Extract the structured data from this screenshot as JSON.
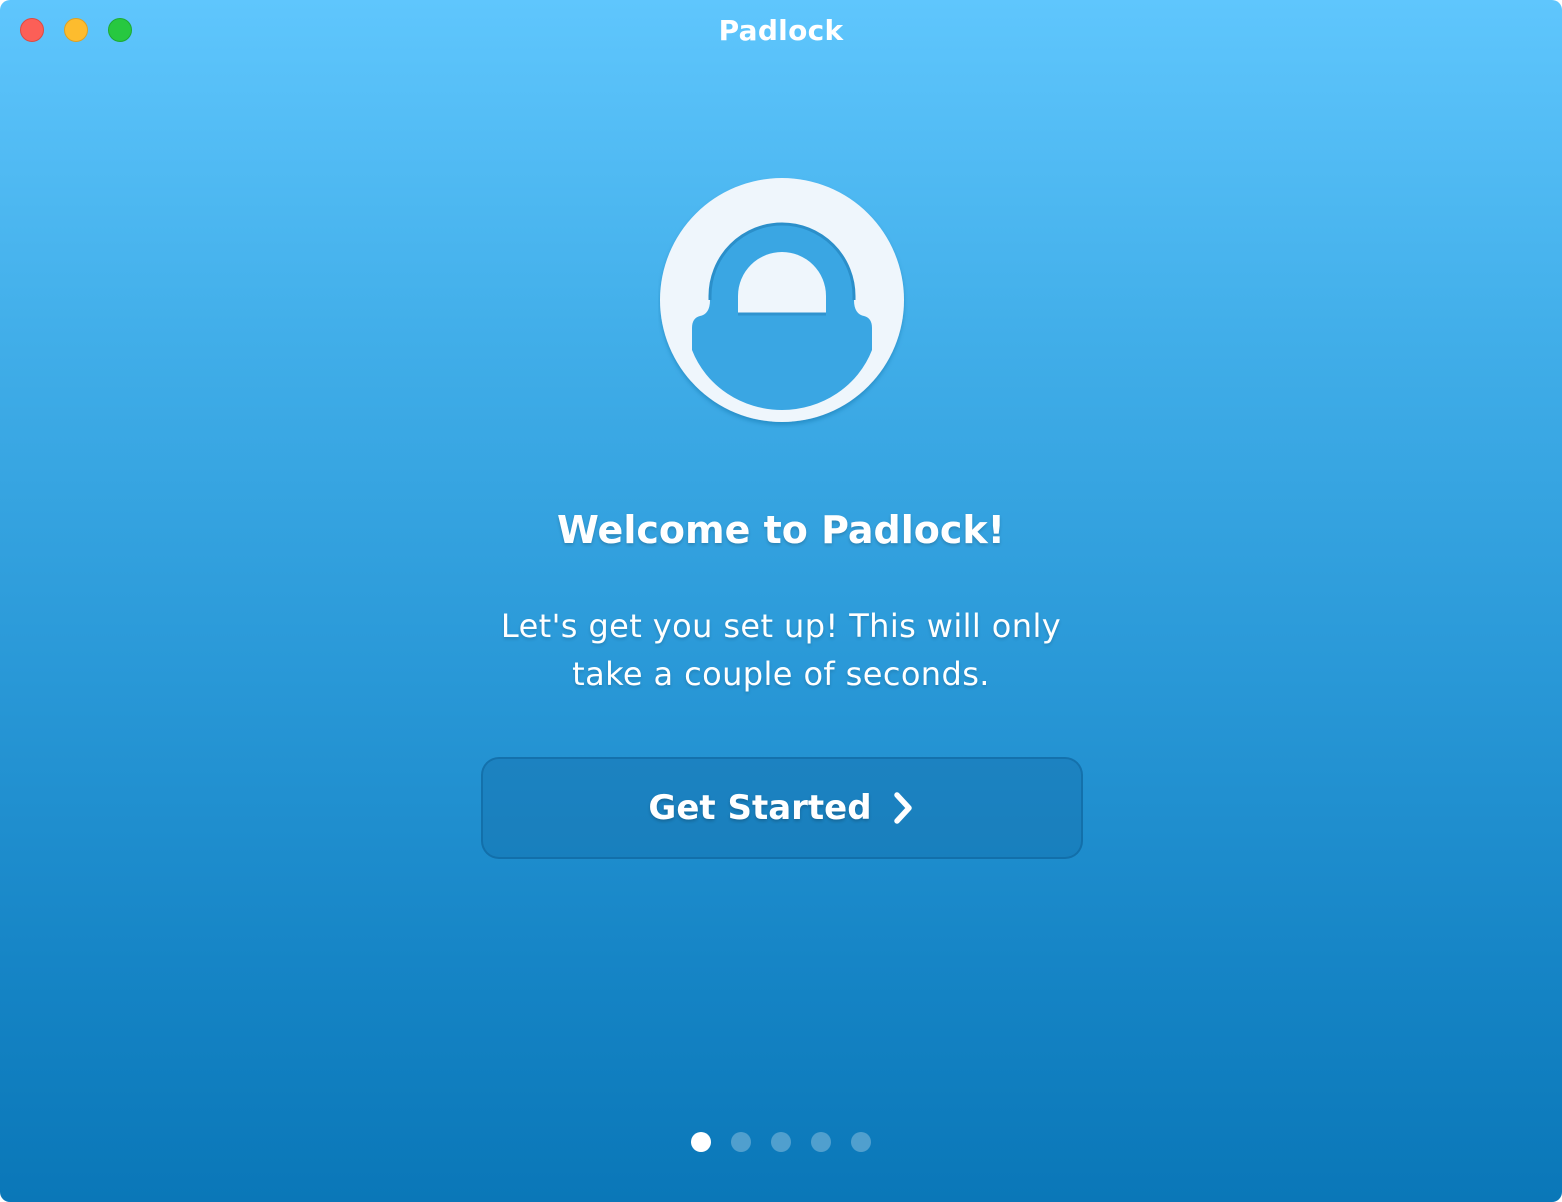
{
  "window": {
    "title": "Padlock",
    "controls": [
      "close",
      "minimize",
      "zoom"
    ]
  },
  "logo": {
    "icon": "padlock-icon"
  },
  "welcome": {
    "heading": "Welcome to Padlock!",
    "subtitle_line1": "Let's get you set up! This will only",
    "subtitle_line2": "take a couple of seconds."
  },
  "cta": {
    "label": "Get Started",
    "icon": "chevron-right-icon"
  },
  "pagination": {
    "total": 5,
    "current": 1
  },
  "colors": {
    "gradient_top": "#5fc6fd",
    "gradient_bottom": "#0a77b8",
    "logo_fill": "#eff6fc",
    "close": "#fc5f57",
    "minimize": "#fdbc2e",
    "zoom": "#27c840"
  }
}
